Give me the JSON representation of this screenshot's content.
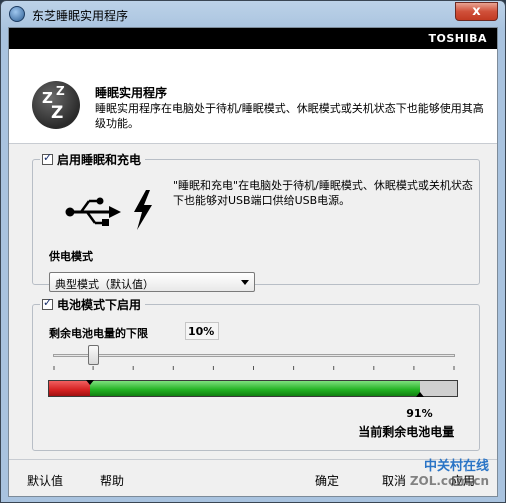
{
  "window": {
    "title": "东芝睡眠实用程序",
    "close_label": "x"
  },
  "brand": "TOSHIBA",
  "header": {
    "title": "睡眠实用程序",
    "description": "睡眠实用程序在电脑处于待机/睡眠模式、休眠模式或关机状态下也能够使用其高级功能。"
  },
  "charge_group": {
    "legend": "启用睡眠和充电",
    "checked": true,
    "description": "\"睡眠和充电\"在电脑处于待机/睡眠模式、休眠模式或关机状态下也能够对USB端口供给USB电源。",
    "mode_label": "供电模式",
    "mode_value": "典型模式（默认值）"
  },
  "battery_group": {
    "legend": "电池模式下启用",
    "checked": true,
    "lower_limit_label": "剩余电池电量的下限",
    "lower_limit_value": "10%",
    "lower_limit_fraction": 0.1,
    "current_value": "91%",
    "current_fraction": 0.91,
    "current_label": "当前剩余电池电量"
  },
  "footer": {
    "default_label": "默认值",
    "help_label": "帮助",
    "ok_label": "确定",
    "cancel_label": "取消",
    "apply_label": "应用"
  },
  "watermark": {
    "cn": "中关村在线",
    "en": "ZOL.com.cn"
  },
  "colors": {
    "low_segment": "#d42020",
    "charge_segment": "#20b020",
    "empty_segment": "#cfcfcf",
    "brand_bar": "#000000"
  }
}
